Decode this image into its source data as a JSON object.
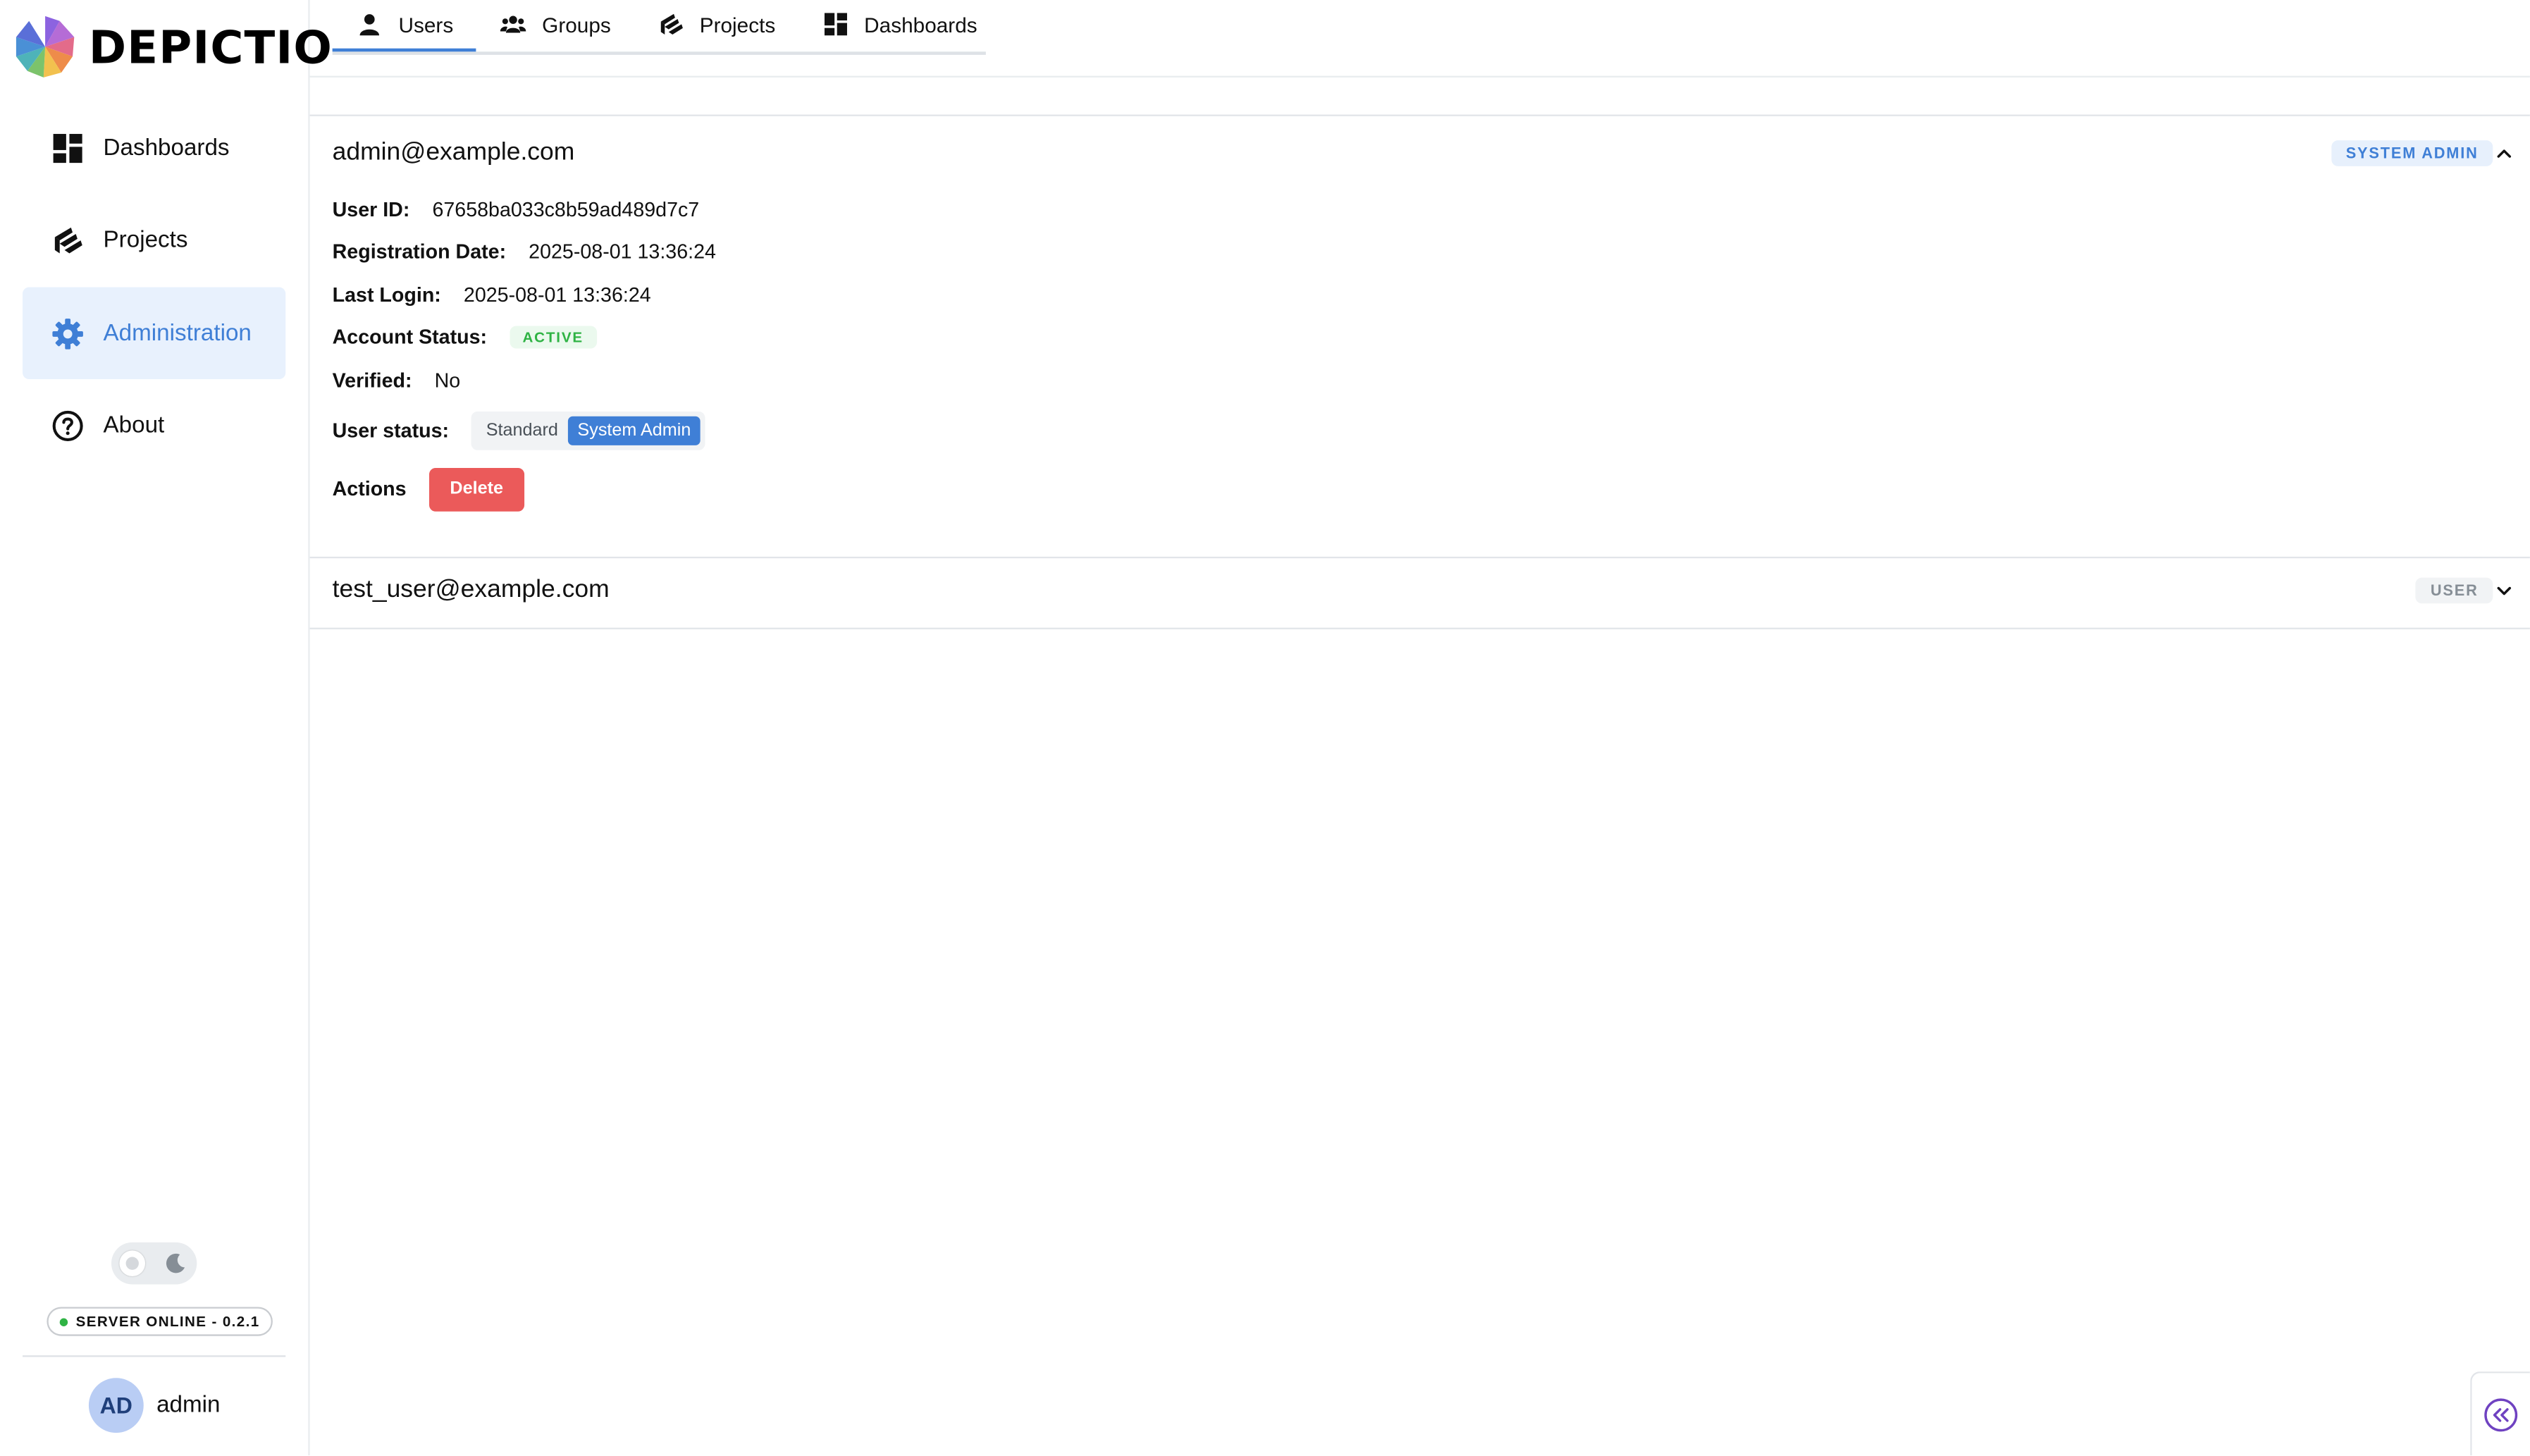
{
  "app": {
    "logo_text": "DEPICTIO"
  },
  "sidebar": {
    "items": [
      {
        "label": "Dashboards",
        "icon": "dashboard-icon"
      },
      {
        "label": "Projects",
        "icon": "projects-icon"
      },
      {
        "label": "Administration",
        "icon": "gear-icon",
        "active": true
      },
      {
        "label": "About",
        "icon": "question-circle-icon"
      }
    ],
    "server_status": "SERVER ONLINE - 0.2.1",
    "user": {
      "initials": "AD",
      "name": "admin"
    }
  },
  "tabs": [
    {
      "label": "Users",
      "icon": "user-icon",
      "active": true
    },
    {
      "label": "Groups",
      "icon": "groups-icon"
    },
    {
      "label": "Projects",
      "icon": "projects-icon"
    },
    {
      "label": "Dashboards",
      "icon": "dashboard-icon"
    }
  ],
  "users": [
    {
      "email": "admin@example.com",
      "badge": "SYSTEM ADMIN",
      "expanded": true,
      "details": {
        "user_id_label": "User ID:",
        "user_id": "67658ba033c8b59ad489d7c7",
        "registration_label": "Registration Date:",
        "registration": "2025-08-01 13:36:24",
        "last_login_label": "Last Login:",
        "last_login": "2025-08-01 13:36:24",
        "account_status_label": "Account Status:",
        "account_status": "ACTIVE",
        "verified_label": "Verified:",
        "verified": "No",
        "user_status_label": "User status:",
        "user_status_options": [
          "Standard",
          "System Admin"
        ],
        "user_status_selected": "System Admin",
        "actions_label": "Actions",
        "delete_label": "Delete"
      }
    },
    {
      "email": "test_user@example.com",
      "badge": "USER",
      "expanded": false
    }
  ],
  "colors": {
    "accent": "#3f7fd6",
    "danger": "#eb5a5a",
    "success": "#2fb344"
  }
}
